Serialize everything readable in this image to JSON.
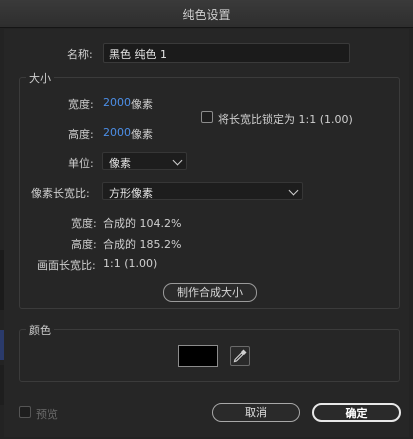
{
  "window": {
    "title": "纯色设置"
  },
  "name": {
    "label": "名称:",
    "value": "黑色 纯色 1"
  },
  "size": {
    "group_label": "大小",
    "width_label": "宽度:",
    "width_value": "2000",
    "width_unit": "像素",
    "height_label": "高度:",
    "height_value": "2000",
    "height_unit": "像素",
    "lock_ratio_label": "将长宽比锁定为 1:1 (1.00)",
    "lock_ratio_checked": false,
    "units_label": "单位:",
    "units_value": "像素",
    "pixel_aspect_label": "像素长宽比:",
    "pixel_aspect_value": "方形像素",
    "comp_width_label": "宽度:",
    "comp_width_value": "合成的 104.2%",
    "comp_height_label": "高度:",
    "comp_height_value": "合成的 185.2%",
    "frame_aspect_label": "画面长宽比:",
    "frame_aspect_value": "1:1 (1.00)",
    "make_comp_size_button": "制作合成大小"
  },
  "color": {
    "group_label": "颜色",
    "swatch_color": "#000000"
  },
  "footer": {
    "preview_label": "预览",
    "preview_checked": false,
    "cancel_button": "取消",
    "ok_button": "确定"
  },
  "colors": {
    "accent_value": "#4c8ee6",
    "background": "#262626"
  }
}
